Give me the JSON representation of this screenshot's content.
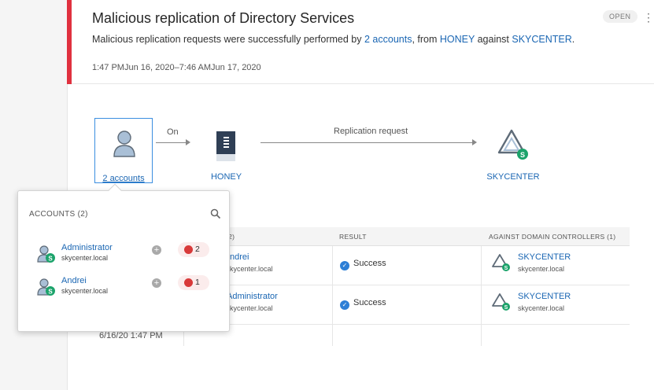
{
  "alert": {
    "title": "Malicious replication of Directory Services",
    "status": "OPEN",
    "description": {
      "prefix": "Malicious replication requests were successfully performed by ",
      "accounts_link": "2 accounts",
      "mid1": ", from ",
      "source_link": "HONEY",
      "mid2": " against ",
      "target_link": "SKYCENTER",
      "suffix": "."
    },
    "timestamp": "1:47 PMJun 16, 2020–7:46 AMJun 17, 2020"
  },
  "diagram": {
    "accounts_label": "2 accounts",
    "edge_on": "On",
    "source_label": "HONEY",
    "edge_request": "Replication request",
    "target_label": "SKYCENTER"
  },
  "table": {
    "columns": [
      "(2)",
      "RESULT",
      "AGAINST DOMAIN CONTROLLERS (1)"
    ],
    "rows": [
      {
        "account_fragment": "ndrei",
        "account_domain_fragment": "kycenter.local",
        "result": "Success",
        "dc": "SKYCENTER",
        "dc_domain": "skycenter.local"
      },
      {
        "account_fragment": "Administrator",
        "account_domain_fragment": "kycenter.local",
        "result": "Success",
        "dc": "SKYCENTER",
        "dc_domain": "skycenter.local"
      }
    ],
    "row_date": "6/16/20 1:47 PM"
  },
  "popover": {
    "title": "ACCOUNTS (2)",
    "items": [
      {
        "name": "Administrator",
        "domain": "skycenter.local",
        "alert_count": "2"
      },
      {
        "name": "Andrei",
        "domain": "skycenter.local",
        "alert_count": "1"
      }
    ]
  },
  "colors": {
    "accent": "#e0313f",
    "link": "#1a66b3",
    "success": "#2d7fd6",
    "status_green": "#1ca36b"
  }
}
